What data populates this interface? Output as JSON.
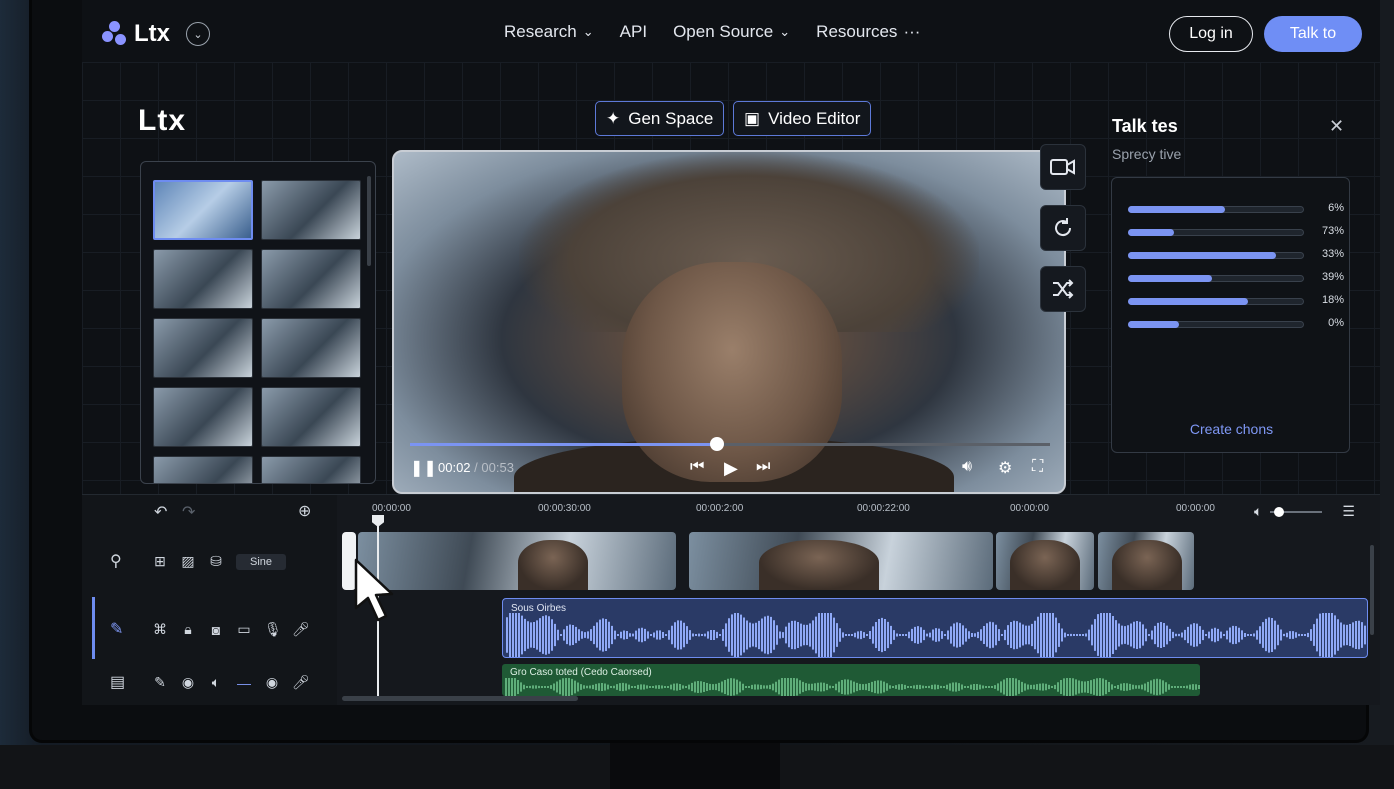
{
  "nav": {
    "logo": "Ltx",
    "menu": [
      {
        "label": "Research",
        "icon": "chevron-down-icon"
      },
      {
        "label": "API"
      },
      {
        "label": "Open Source",
        "icon": "chevron-down-icon"
      },
      {
        "label": "Resources",
        "icon": "more-horizontal-icon"
      }
    ],
    "login": "Log in",
    "cta": "Talk to"
  },
  "editor": {
    "logo": "Ltx",
    "modes": [
      {
        "label": "Gen Space",
        "icon": "sparkles-icon"
      },
      {
        "label": "Video Editor",
        "icon": "film-icon"
      }
    ]
  },
  "player": {
    "current": "00:02",
    "duration": "/ 00:53",
    "progress": 0.48,
    "tools": [
      "video-camera-icon",
      "refresh-icon",
      "shuffle-icon"
    ]
  },
  "panel": {
    "title": "Talk tes",
    "subtitle": "Sprecy tive",
    "close": "✕",
    "bars": [
      {
        "fill": 0.55,
        "value": "6%"
      },
      {
        "fill": 0.26,
        "value": "73%"
      },
      {
        "fill": 0.84,
        "value": "33%"
      },
      {
        "fill": 0.48,
        "value": "39%"
      },
      {
        "fill": 0.68,
        "value": "18%"
      },
      {
        "fill": 0.29,
        "value": "0%"
      }
    ],
    "link": "Create chons"
  },
  "timeline": {
    "ruler": [
      "00:00:00",
      "00:00:30:00",
      "00:00:2:00",
      "00:00:22:00",
      "00:00:00",
      "00:00:00"
    ],
    "side_button": "Sine",
    "audio_label": "Sous Oirbes",
    "music_label": "Gro Caso toted (Cedo Caorsed)"
  },
  "colors": {
    "accent": "#6f8ef5",
    "audio": "#2a3a66",
    "music": "#1f5a35"
  }
}
